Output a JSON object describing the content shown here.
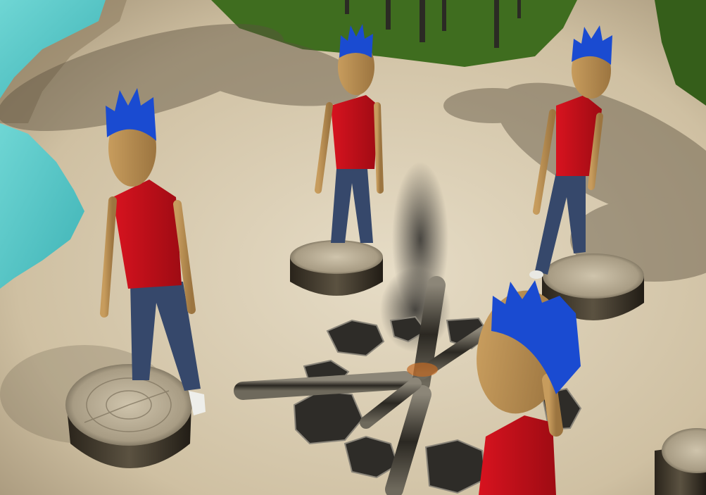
{
  "scene": {
    "characters": [
      {
        "id": "left"
      },
      {
        "id": "middle"
      },
      {
        "id": "right"
      },
      {
        "id": "foreground"
      }
    ],
    "stumps": [
      {
        "id": "left"
      },
      {
        "id": "middle"
      },
      {
        "id": "right"
      },
      {
        "id": "edge"
      }
    ]
  },
  "colors": {
    "water": "#58c9c9",
    "sand": "#d9ccb1",
    "grass": "#3c6b1e",
    "shirt": "#c8101b",
    "hair": "#1a4bd1",
    "pants": "#36486b",
    "skin": "#b48a4e",
    "stump_top": "#b9ad95",
    "stump_bark": "#3a3428",
    "smoke": "#3a3a38"
  }
}
